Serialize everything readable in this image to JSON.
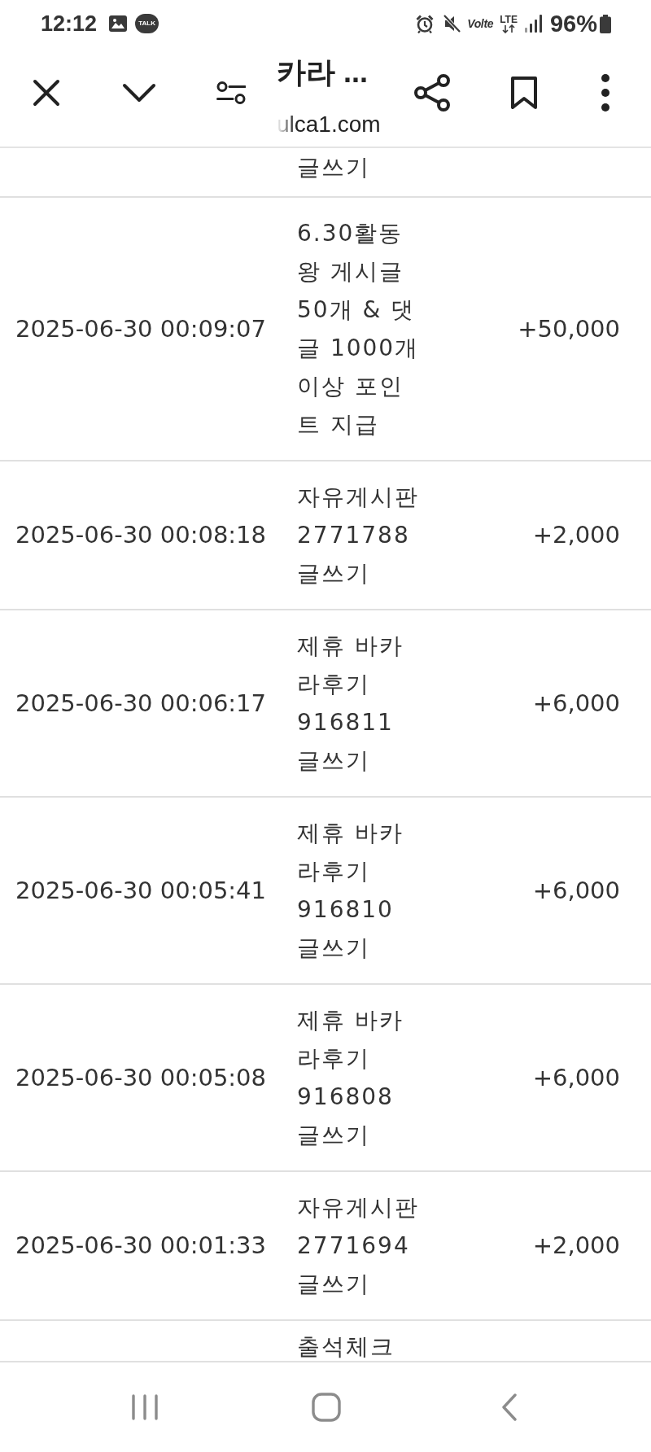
{
  "status_bar": {
    "time": "12:12",
    "chat_badge": "TALK",
    "volte": "Volte",
    "network": "LTE",
    "battery": "96%"
  },
  "toolbar": {
    "title": "카라 ...",
    "url": "ulca1.com"
  },
  "table": {
    "rows": [
      {
        "column_2": "글쓰기"
      },
      {
        "column_1": "2025-06-30 00:09:07",
        "column_2": "6.30활동 왕 게시글 50개 & 댓글 1000개 이상 포인트 지급",
        "column_3": "+50,000"
      },
      {
        "column_1": "2025-06-30 00:08:18",
        "column_2": "자유게시판 2771788 글쓰기",
        "column_3": "+2,000"
      },
      {
        "column_1": "2025-06-30 00:06:17",
        "column_2": "제휴 바카라후기 916811 글쓰기",
        "column_3": "+6,000"
      },
      {
        "column_1": "2025-06-30 00:05:41",
        "column_2": "제휴 바카라후기 916810 글쓰기",
        "column_3": "+6,000"
      },
      {
        "column_1": "2025-06-30 00:05:08",
        "column_2": "제휴 바카라후기 916808 글쓰기",
        "column_3": "+6,000"
      },
      {
        "column_1": "2025-06-30 00:01:33",
        "column_2": "자유게시판 2771694 글쓰기",
        "column_3": "+2,000"
      },
      {
        "column_2": "출석체크"
      }
    ]
  }
}
